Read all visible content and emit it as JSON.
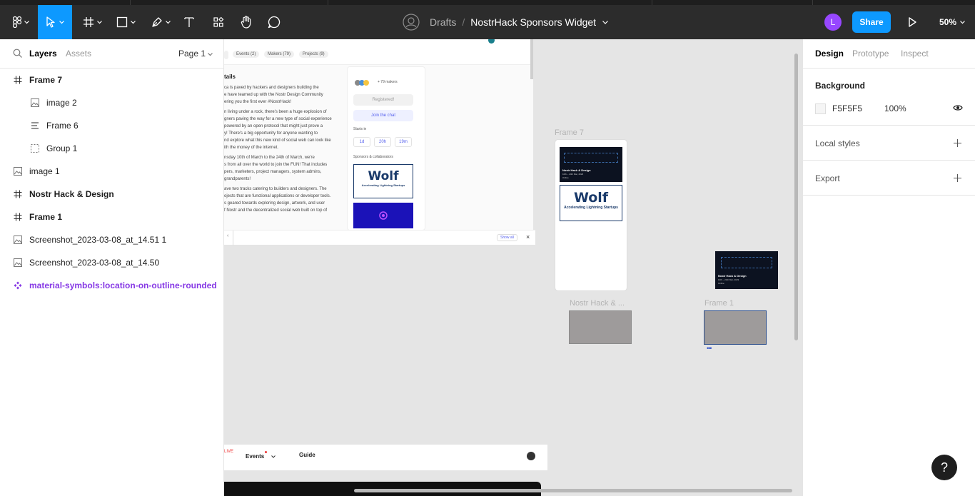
{
  "toolbar": {
    "breadcrumb_drafts": "Drafts",
    "breadcrumb_sep": "/",
    "file_name": "NostrHack Sponsors Widget",
    "avatar_letter": "L",
    "share_label": "Share",
    "zoom": "50%"
  },
  "left_panel": {
    "tab_layers": "Layers",
    "tab_assets": "Assets",
    "page_label": "Page 1",
    "layers": [
      {
        "name": "Frame 7",
        "type": "frame-icon"
      },
      {
        "name": "image 2",
        "type": "image-icon"
      },
      {
        "name": "Frame 6",
        "type": "auto-layout-icon"
      },
      {
        "name": "Group 1",
        "type": "group-icon"
      },
      {
        "name": "image 1",
        "type": "image-icon"
      },
      {
        "name": "Nostr Hack & Design",
        "type": "frame-icon"
      },
      {
        "name": "Frame 1",
        "type": "frame-icon"
      },
      {
        "name": "Screenshot_2023-03-08_at_14.51 1",
        "type": "image-icon"
      },
      {
        "name": "Screenshot_2023-03-08_at_14.50",
        "type": "image-icon"
      },
      {
        "name": "material-symbols:location-on-outline-rounded",
        "type": "component-icon"
      }
    ]
  },
  "canvas": {
    "tabs": [
      "Events (2)",
      "Makers (79)",
      "Projects (9)"
    ],
    "details_title": "tails",
    "details_lines": [
      "ca is paved by hackers and designers building the",
      "e have teamed up with the Nostr Design Community",
      "ering you the first ever #NostrHack!",
      "n living under a rock, there's been a huge explosion of",
      "gners paving the way for a new type of social experience",
      "powered by an open protocol that might just prove a",
      "y! There's a big opportunity for anyone wanting to",
      "nd explore what this new kind of social web can look like",
      "ith the money of the internet.",
      "nsday 10th of March to the 24th of March, we're",
      "s from all over the world to join the FUN! That includes",
      "pers, marketers, project managers, system admins,",
      "grandparents!",
      "ave two tracks catering to builders and designers. The",
      "ojects that are functional applications or developer tools.",
      "s geared towards exploring design, artwork, and user",
      "f Nostr and the decentralized social web built on top of"
    ],
    "makers_count": "+ 79 makers",
    "registered_label": "Registered!",
    "join_chat_label": "Join the chat",
    "starts_in_label": "Starts in",
    "countdown": [
      "1d",
      "20h",
      "19m"
    ],
    "sponsors_label": "Sponsors & collaborators",
    "wolf_text": "Wolf",
    "wolf_sub": "Accelerating Lightning Startups",
    "show_all_label": "Show all",
    "nav_live": "LIVE",
    "nav_events": "Events",
    "nav_guide": "Guide",
    "frame7_label": "Frame 7",
    "banner_title": "Nostr Hack & Design",
    "banner_date": "10th – 24th Mar, 2023",
    "banner_online": "Online",
    "frame_nostr_label": "Nostr Hack & ...",
    "frame1_label": "Frame 1"
  },
  "right_panel": {
    "tab_design": "Design",
    "tab_prototype": "Prototype",
    "tab_inspect": "Inspect",
    "background_label": "Background",
    "bg_hex": "F5F5F5",
    "bg_opacity": "100%",
    "local_styles_label": "Local styles",
    "export_label": "Export"
  },
  "help_label": "?",
  "colors": {
    "accent": "#0d99ff",
    "toolbar": "#2c2c2c",
    "purple": "#8638e5",
    "avatar": "#9747ff"
  }
}
